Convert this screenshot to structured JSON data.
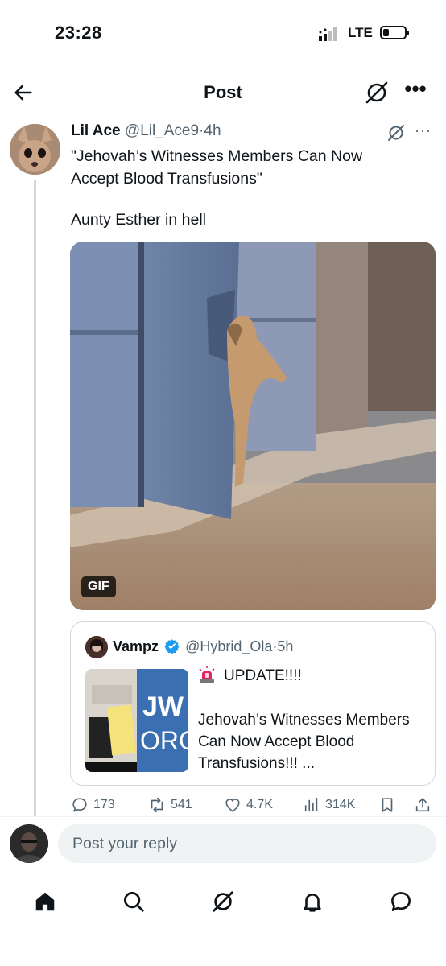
{
  "status_bar": {
    "time": "23:28",
    "network": "LTE",
    "battery_level": 0.2
  },
  "header": {
    "title": "Post",
    "back_icon": "arrow-left-icon",
    "grok_icon": "grok-icon",
    "more_icon": "more-horizontal-icon"
  },
  "post": {
    "author_name": "Lil Ace",
    "author_handle": "@Lil_Ace9",
    "separator": "·",
    "time": "4h",
    "text_line_1": "\"Jehovah’s Witnesses Members Can Now Accept Blood Transfusions\"",
    "text_line_2": "Aunty Esther in hell",
    "media_badge": "GIF",
    "more_label": "···"
  },
  "quote": {
    "author_name": "Vampz",
    "author_handle": "@Hybrid_Ola",
    "separator": "·",
    "time": "5h",
    "update_text": "UPDATE!!!!",
    "body": "Jehovah’s Witnesses Members Can Now Accept Blood Transfusions!!! ...",
    "verified_color": "#1d9bf0"
  },
  "actions": {
    "replies": "173",
    "reposts": "541",
    "likes": "4.7K",
    "views": "314K"
  },
  "reply": {
    "placeholder": "Post your reply"
  },
  "nav": {
    "items": [
      "home-icon",
      "search-icon",
      "grok-icon",
      "notifications-icon",
      "messages-icon"
    ]
  },
  "colors": {
    "text": "#0f1419",
    "secondary": "#536471",
    "border": "#cfd9de",
    "accent": "#1d9bf0"
  }
}
